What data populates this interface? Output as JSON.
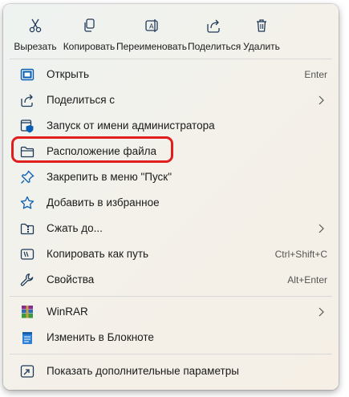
{
  "toolbar": {
    "cut_label": "Вырезать",
    "copy_label": "Копировать",
    "rename_label": "Переименовать",
    "share_label": "Поделиться",
    "delete_label": "Удалить"
  },
  "menu": {
    "open": {
      "label": "Открыть",
      "shortcut": "Enter"
    },
    "share_with": {
      "label": "Поделиться с"
    },
    "run_as_admin": {
      "label": "Запуск от имени администратора"
    },
    "file_location": {
      "label": "Расположение файла"
    },
    "pin_start": {
      "label": "Закрепить в меню \"Пуск\""
    },
    "add_favorites": {
      "label": "Добавить в избранное"
    },
    "compress": {
      "label": "Сжать до..."
    },
    "copy_path": {
      "label": "Копировать как путь",
      "shortcut": "Ctrl+Shift+C"
    },
    "properties": {
      "label": "Свойства",
      "shortcut": "Alt+Enter"
    },
    "winrar": {
      "label": "WinRAR"
    },
    "notepad": {
      "label": "Изменить в Блокноте"
    },
    "more_options": {
      "label": "Показать дополнительные параметры"
    }
  },
  "colors": {
    "highlight_border": "#e01e1e",
    "accent_blue": "#0a5fb4"
  }
}
